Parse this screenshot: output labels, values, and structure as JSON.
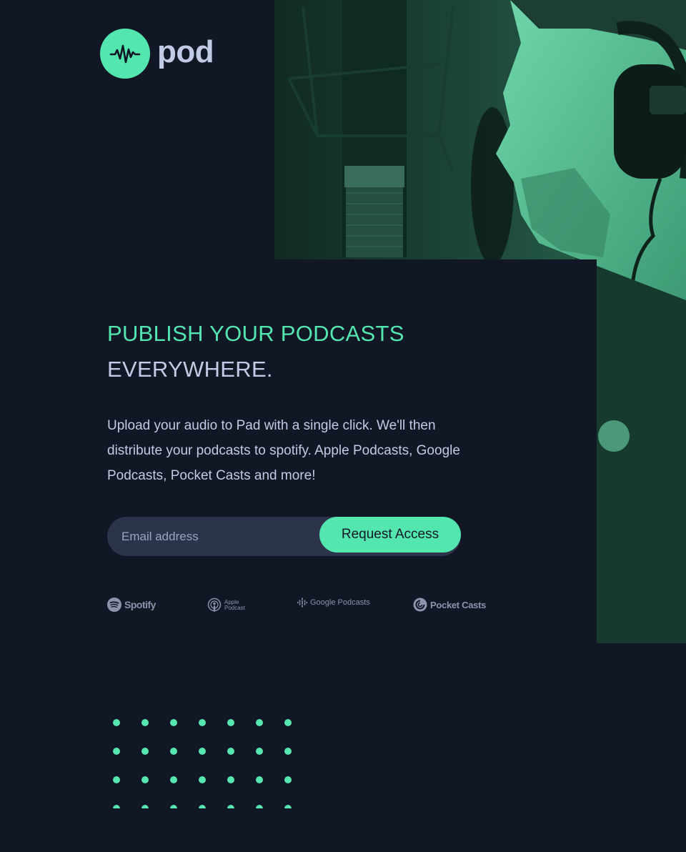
{
  "brand": {
    "name": "pod",
    "logo_icon": "waveform-icon",
    "accent_color": "#54E6AF",
    "text_color": "#C2CBE5",
    "background_color": "#121725"
  },
  "hero": {
    "headline_accent": "PUBLISH YOUR PODCASTS",
    "headline_rest": "EVERYWHERE.",
    "description": "Upload your audio to Pad with a single click. We'll then distribute your podcasts to spotify. Apple Podcasts, Google Podcasts, Pocket Casts and more!",
    "photo_icon": "podcaster-microphone-photo"
  },
  "signup": {
    "email_placeholder": "Email address",
    "button_label": "Request Access"
  },
  "platforms": {
    "spotify": "Spotify",
    "apple_line1": "Apple",
    "apple_line2": "Podcast",
    "google": "Google Podcasts",
    "pocket": "Pocket Casts"
  },
  "decoration": {
    "dot_grid_icon": "dot-pattern"
  }
}
